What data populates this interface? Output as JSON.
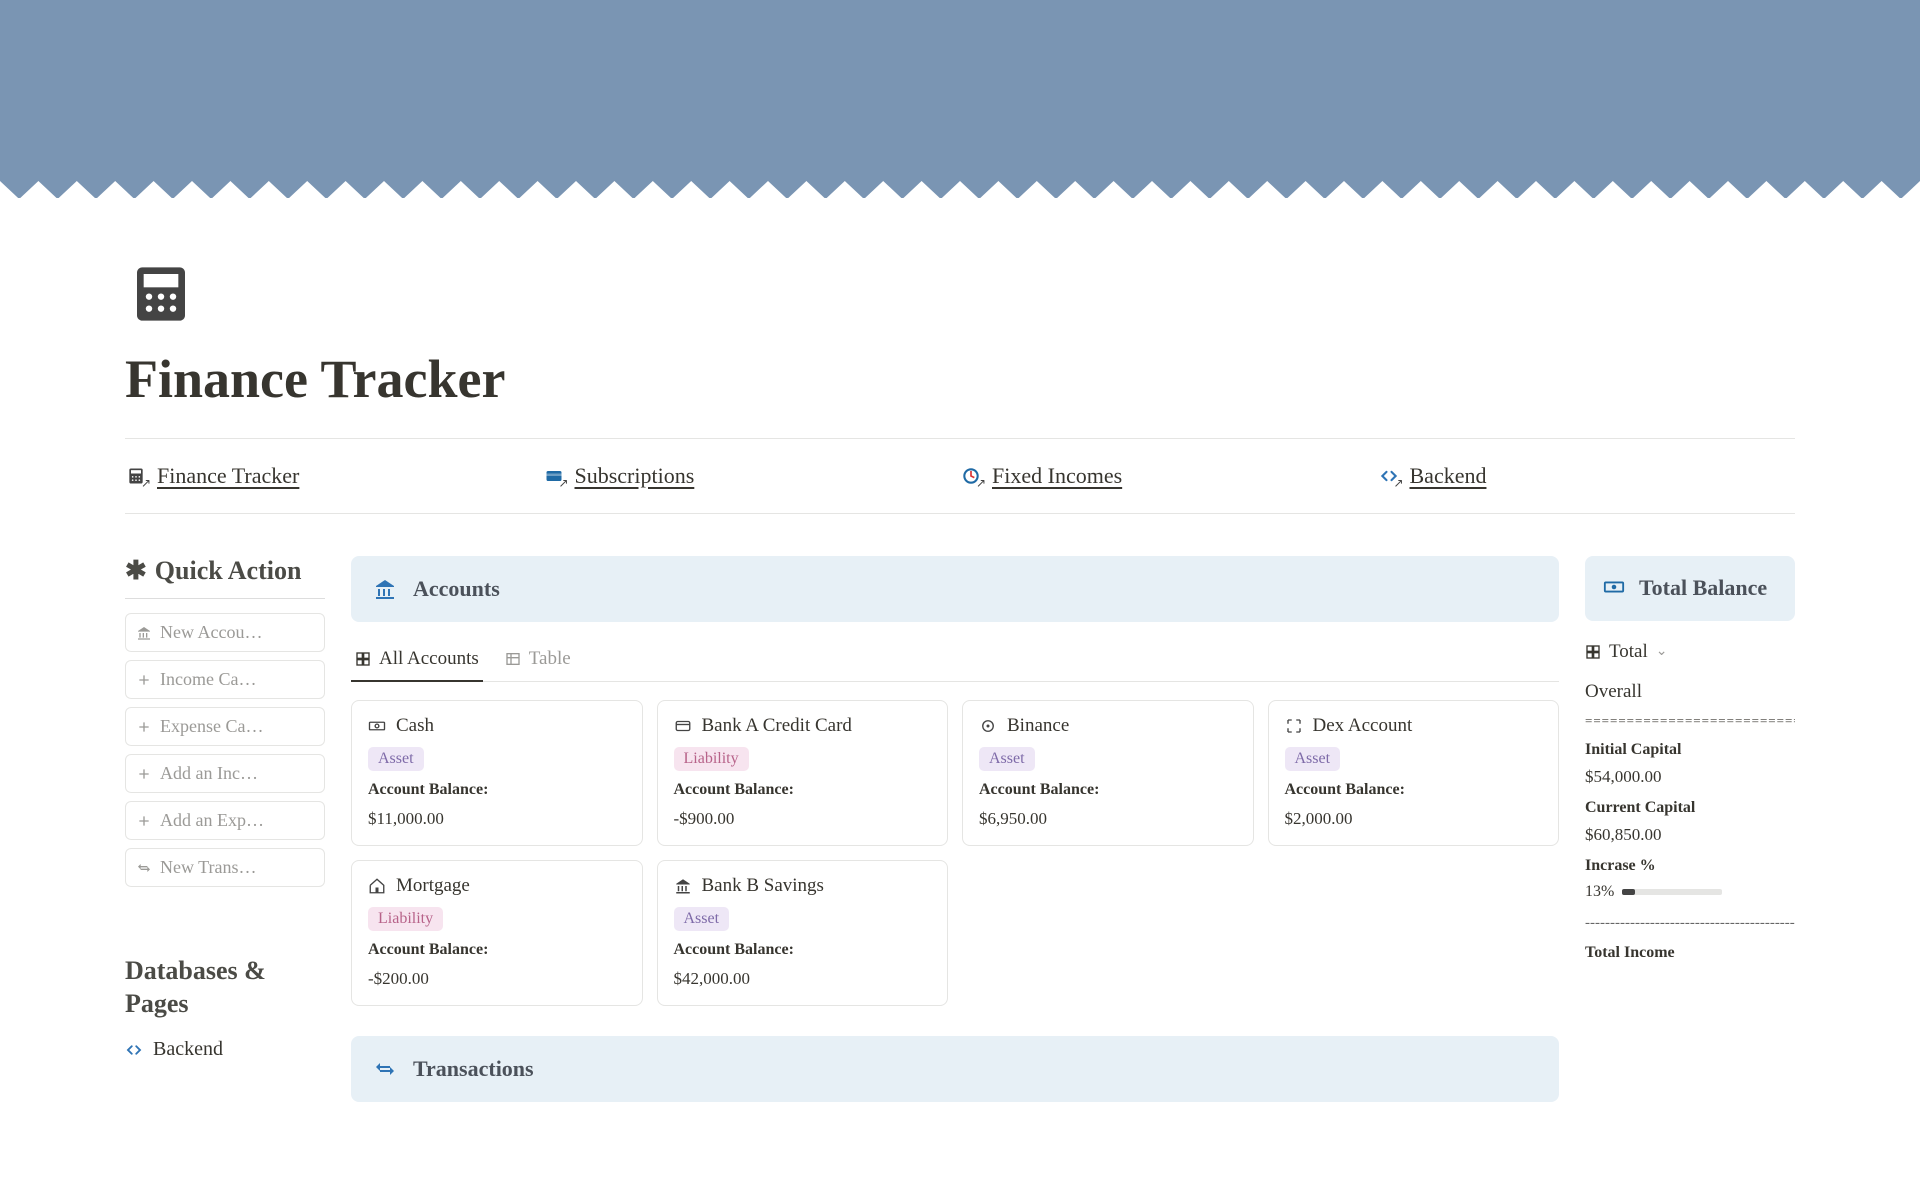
{
  "page": {
    "title": "Finance Tracker"
  },
  "topLinks": [
    {
      "label": "Finance Tracker"
    },
    {
      "label": "Subscriptions"
    },
    {
      "label": "Fixed Incomes"
    },
    {
      "label": "Backend"
    }
  ],
  "sidebar": {
    "quickActionTitle": "Quick Action",
    "dbPagesTitle": "Databases & Pages",
    "actions": [
      {
        "label": "New Accou…"
      },
      {
        "label": "Income Ca…"
      },
      {
        "label": "Expense Ca…"
      },
      {
        "label": "Add an Inc…"
      },
      {
        "label": "Add an Exp…"
      },
      {
        "label": "New Trans…"
      }
    ],
    "dbItems": [
      {
        "label": "Backend"
      }
    ]
  },
  "accounts": {
    "heading": "Accounts",
    "tabs": {
      "all": "All Accounts",
      "table": "Table"
    },
    "balanceLabel": "Account Balance:",
    "cards": [
      {
        "name": "Cash",
        "type": "Asset",
        "balance": "$11,000.00"
      },
      {
        "name": "Bank A Credit Card",
        "type": "Liability",
        "balance": "-$900.00"
      },
      {
        "name": "Binance",
        "type": "Asset",
        "balance": "$6,950.00"
      },
      {
        "name": "Dex Account",
        "type": "Asset",
        "balance": "$2,000.00"
      },
      {
        "name": "Mortgage",
        "type": "Liability",
        "balance": "-$200.00"
      },
      {
        "name": "Bank B Savings",
        "type": "Asset",
        "balance": "$42,000.00"
      }
    ]
  },
  "transactions": {
    "heading": "Transactions"
  },
  "totalBalance": {
    "heading": "Total Balance",
    "totalLabel": "Total",
    "overallLabel": "Overall",
    "sep1": "============================",
    "initialCapitalLabel": "Initial Capital",
    "initialCapitalValue": "$54,000.00",
    "currentCapitalLabel": "Current Capital",
    "currentCapitalValue": "$60,850.00",
    "increaseLabel": "Incrase %",
    "increasePercent": "13%",
    "progressFill": 13,
    "dashed": "------------------------------------------------",
    "totalIncomeLabel": "Total Income"
  }
}
